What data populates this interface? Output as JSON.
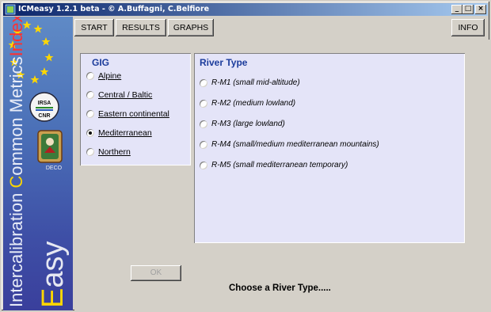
{
  "window": {
    "title": "ICMeasy 1.2.1 beta  -  © A.Buffagni, C.Belfiore",
    "controls": {
      "minimize": "_",
      "maximize": "□",
      "close": "×"
    }
  },
  "sidebar": {
    "vertical_text_1": "Intercalibration ",
    "vertical_text_hl": "C",
    "vertical_text_2": "ommon Metrics",
    "vertical_text_idx": "Index",
    "easy_1": "",
    "easy_hl": "E",
    "easy_2": "asy",
    "logos": {
      "irsa": "IRSA",
      "cnr": "CNR",
      "deco": "DECO"
    }
  },
  "menu": {
    "start": "START",
    "results": "RESULTS",
    "graphs": "GRAPHS",
    "info": "INFO"
  },
  "gig": {
    "title": "GIG",
    "options": [
      "Alpine",
      "Central / Baltic",
      "Eastern continental",
      "Mediterranean",
      "Northern"
    ],
    "selected": "Mediterranean"
  },
  "river_type": {
    "title": "River Type",
    "options": [
      "R-M1 (small mid-altitude)",
      "R-M2 (medium lowland)",
      "R-M3 (large lowland)",
      "R-M4 (small/medium mediterranean mountains)",
      "R-M5 (small mediterranean temporary)"
    ]
  },
  "ok_label": "OK",
  "status_text": "Choose a River Type....."
}
